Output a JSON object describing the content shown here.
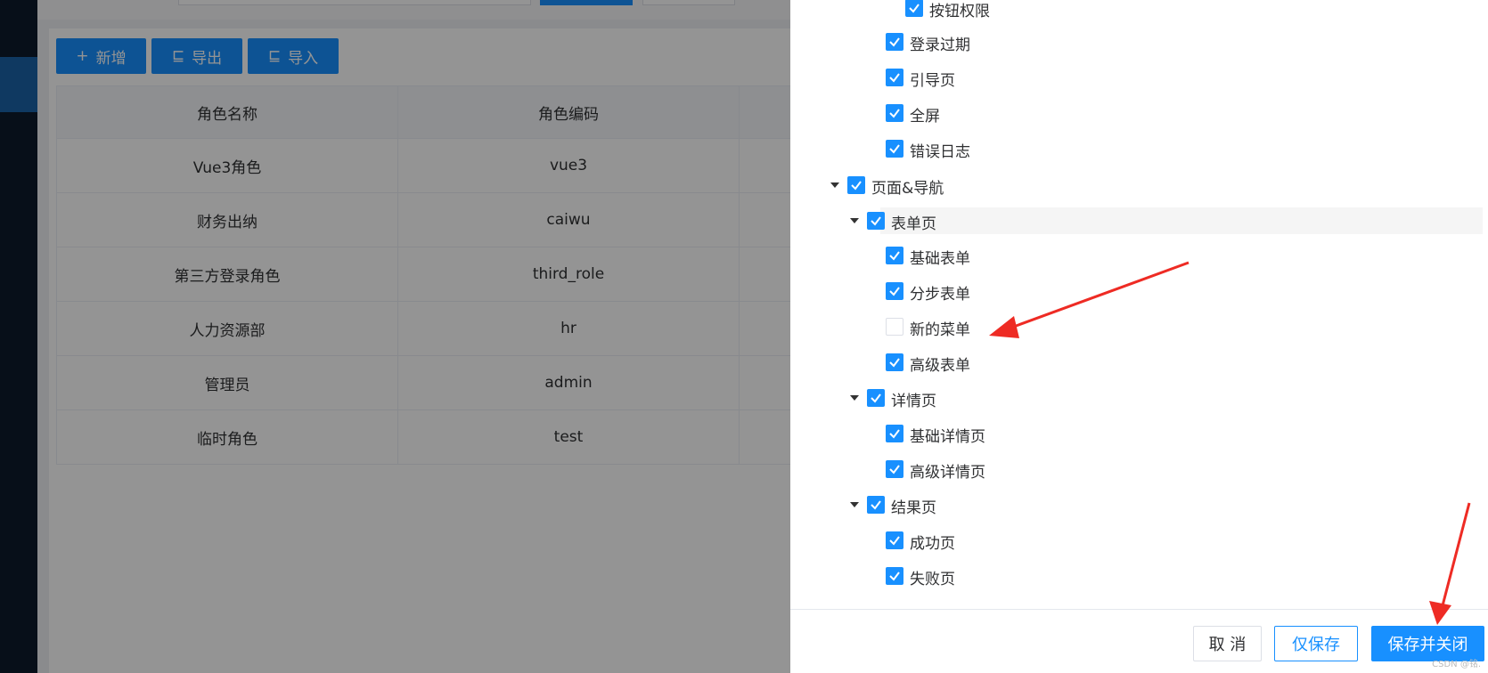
{
  "toolbar": {
    "add_label": "新增",
    "export_label": "导出",
    "import_label": "导入"
  },
  "table": {
    "headers": [
      "角色名称",
      "角色编码"
    ],
    "rows": [
      [
        "Vue3角色",
        "vue3"
      ],
      [
        "财务出纳",
        "caiwu"
      ],
      [
        "第三方登录角色",
        "third_role"
      ],
      [
        "人力资源部",
        "hr"
      ],
      [
        "管理员",
        "admin"
      ],
      [
        "临时角色",
        "test"
      ]
    ]
  },
  "tree": {
    "items": [
      {
        "label": "按钮权限",
        "checked": true,
        "expandable": false
      },
      {
        "label": "登录过期",
        "checked": true,
        "expandable": false
      },
      {
        "label": "引导页",
        "checked": true,
        "expandable": false
      },
      {
        "label": "全屏",
        "checked": true,
        "expandable": false
      },
      {
        "label": "错误日志",
        "checked": true,
        "expandable": false
      },
      {
        "label": "页面&导航",
        "checked": true,
        "expandable": true
      },
      {
        "label": "表单页",
        "checked": true,
        "expandable": true,
        "highlighted": true
      },
      {
        "label": "基础表单",
        "checked": true,
        "expandable": false
      },
      {
        "label": "分步表单",
        "checked": true,
        "expandable": false
      },
      {
        "label": "新的菜单",
        "checked": false,
        "expandable": false
      },
      {
        "label": "高级表单",
        "checked": true,
        "expandable": false
      },
      {
        "label": "详情页",
        "checked": true,
        "expandable": true
      },
      {
        "label": "基础详情页",
        "checked": true,
        "expandable": false
      },
      {
        "label": "高级详情页",
        "checked": true,
        "expandable": false
      },
      {
        "label": "结果页",
        "checked": true,
        "expandable": true
      },
      {
        "label": "成功页",
        "checked": true,
        "expandable": false
      },
      {
        "label": "失败页",
        "checked": true,
        "expandable": false
      }
    ]
  },
  "footer": {
    "cancel_label": "取 消",
    "save_label": "仅保存",
    "save_close_label": "保存并关闭",
    "watermark": "CSDN @铭."
  },
  "colors": {
    "primary": "#1890ff",
    "sidebar": "#0d1a2b",
    "annotation_arrow": "#ee2b24"
  }
}
